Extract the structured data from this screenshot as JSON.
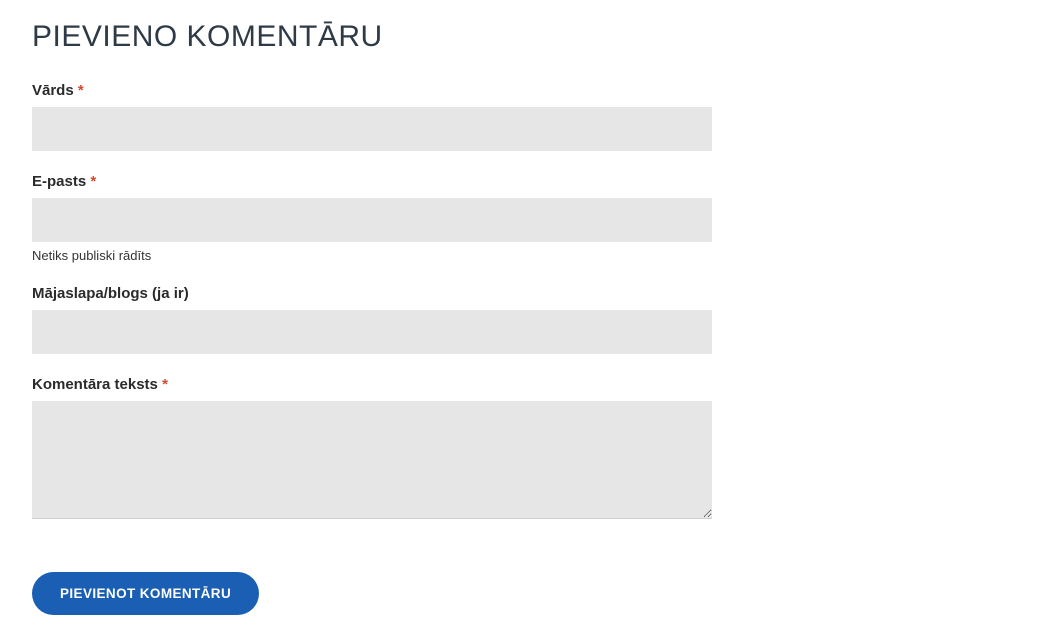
{
  "heading": "PIEVIENO KOMENTĀRU",
  "required_marker": "*",
  "fields": {
    "name": {
      "label": "Vārds",
      "required": true,
      "value": ""
    },
    "email": {
      "label": "E-pasts",
      "required": true,
      "help": "Netiks publiski rādīts",
      "value": ""
    },
    "website": {
      "label": "Mājaslapa/blogs (ja ir)",
      "required": false,
      "value": ""
    },
    "comment": {
      "label": "Komentāra teksts",
      "required": true,
      "value": ""
    }
  },
  "submit_label": "PIEVIENOT KOMENTĀRU"
}
